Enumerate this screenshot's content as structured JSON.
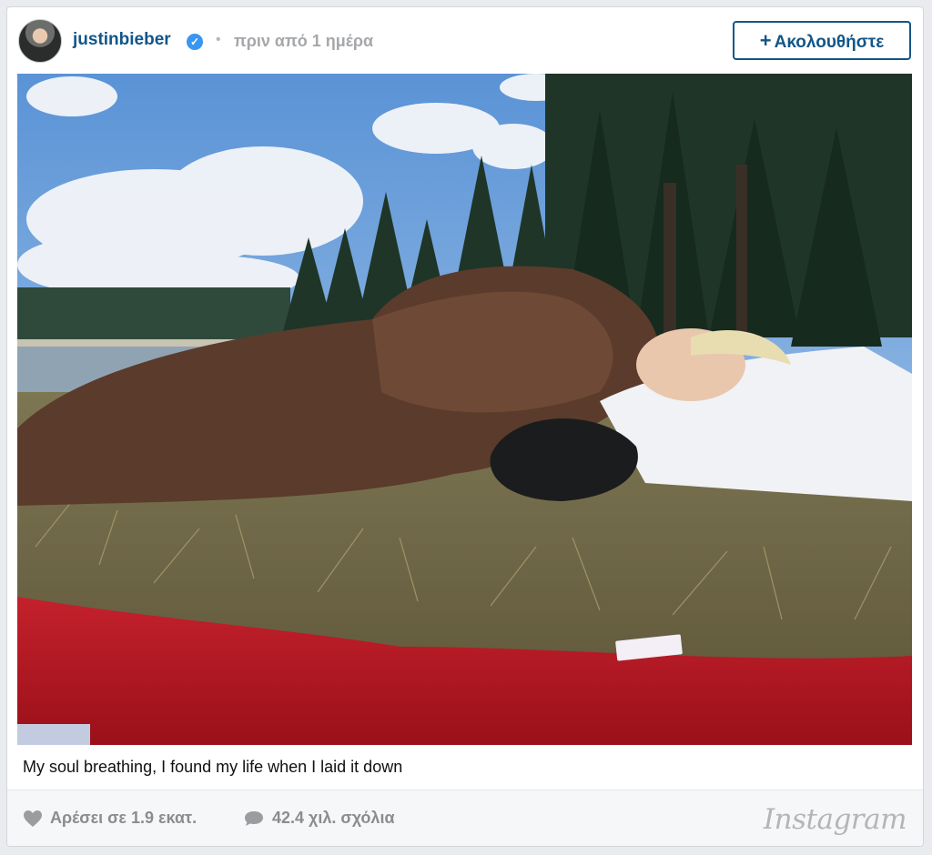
{
  "header": {
    "username": "justinbieber",
    "verified_icon": "check-badge-icon",
    "separator": "•",
    "timestamp": "πριν από 1 ημέρα",
    "follow_label": "Ακολουθήστε",
    "follow_icon": "+"
  },
  "post": {
    "caption": "My soul breathing, I found my life when I laid it down"
  },
  "footer": {
    "likes_label": "Αρέσει σε 1.9 εκατ.",
    "comments_label": "42.4 χιλ. σχόλια",
    "logo": "Instagram"
  },
  "colors": {
    "link_blue": "#125688",
    "verified_blue": "#3897f0",
    "muted_gray": "#8a8d90"
  }
}
